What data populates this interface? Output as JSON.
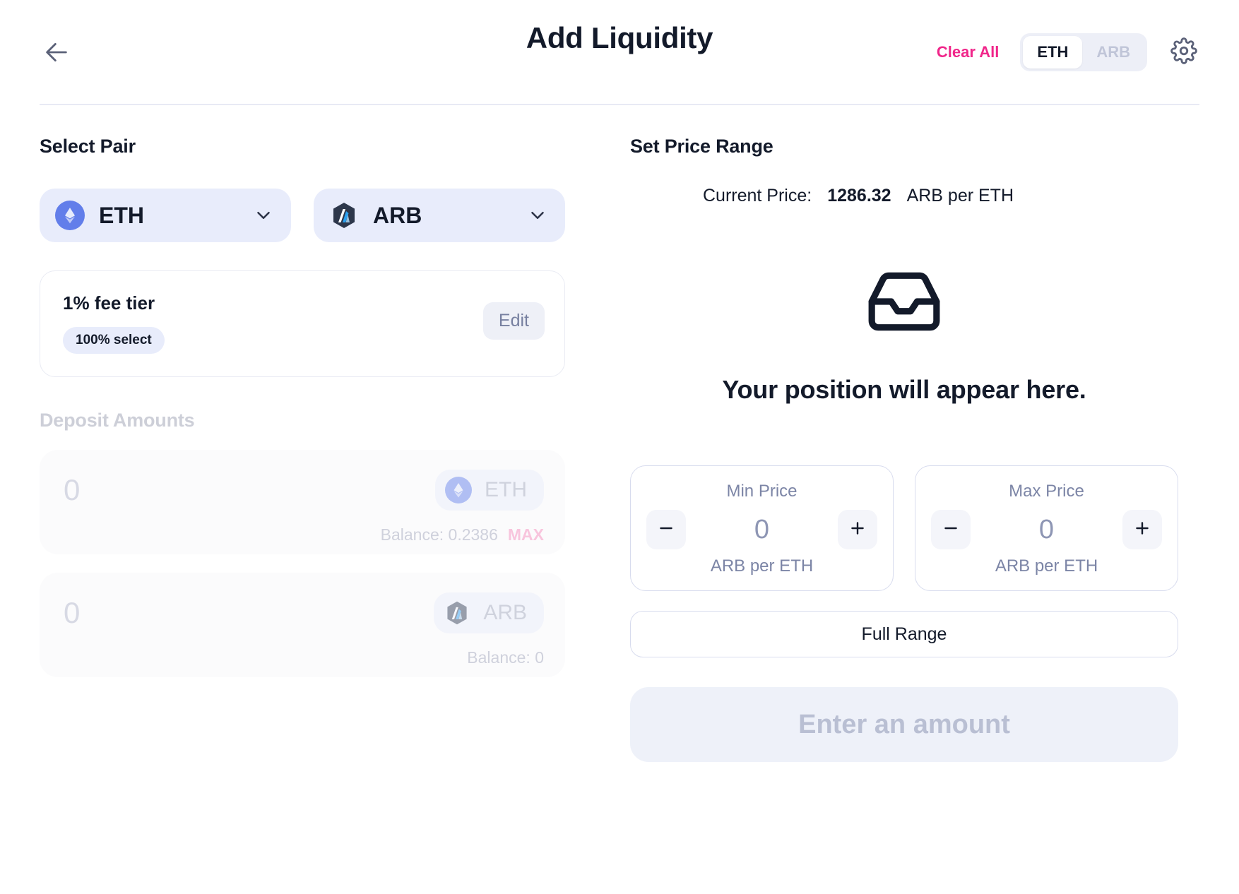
{
  "header": {
    "back_icon": "arrow-left-icon",
    "title": "Add Liquidity",
    "clear_all": "Clear All",
    "rate_toggle": {
      "options": [
        "ETH",
        "ARB"
      ],
      "selected": "ETH"
    },
    "settings_icon": "gear-icon"
  },
  "left": {
    "select_pair_title": "Select Pair",
    "tokens": [
      {
        "symbol": "ETH",
        "logo": "ethereum-logo-icon",
        "chevron": "chevron-down-icon"
      },
      {
        "symbol": "ARB",
        "logo": "arbitrum-logo-icon",
        "chevron": "chevron-down-icon"
      }
    ],
    "fee_tier": {
      "title": "1% fee tier",
      "badge": "100% select",
      "edit_label": "Edit"
    },
    "deposit": {
      "title": "Deposit Amounts",
      "rows": [
        {
          "amount": "0",
          "symbol": "ETH",
          "logo": "ethereum-logo-icon",
          "balance_label": "Balance: 0.2386",
          "max_label": "MAX"
        },
        {
          "amount": "0",
          "symbol": "ARB",
          "logo": "arbitrum-logo-icon",
          "balance_label": "Balance: 0",
          "max_label": ""
        }
      ]
    }
  },
  "right": {
    "set_price_range_title": "Set Price Range",
    "current_price": {
      "label": "Current Price:",
      "value": "1286.32",
      "unit": "ARB per ETH"
    },
    "empty_state": {
      "icon": "inbox-tray-icon",
      "caption": "Your position will appear here."
    },
    "range": [
      {
        "label": "Min Price",
        "value": "0",
        "unit": "ARB per ETH",
        "decrement_icon": "minus-icon",
        "increment_icon": "plus-icon"
      },
      {
        "label": "Max Price",
        "value": "0",
        "unit": "ARB per ETH",
        "decrement_icon": "minus-icon",
        "increment_icon": "plus-icon"
      }
    ],
    "full_range_label": "Full Range",
    "primary_action_label": "Enter an amount"
  },
  "colors": {
    "accent_pink": "#f0268a",
    "text_primary": "#131a2a",
    "muted": "#7c85a6",
    "chip_bg": "#e8ecfb",
    "eth_brand": "#627eea",
    "arb_brand": "#2d374b"
  }
}
